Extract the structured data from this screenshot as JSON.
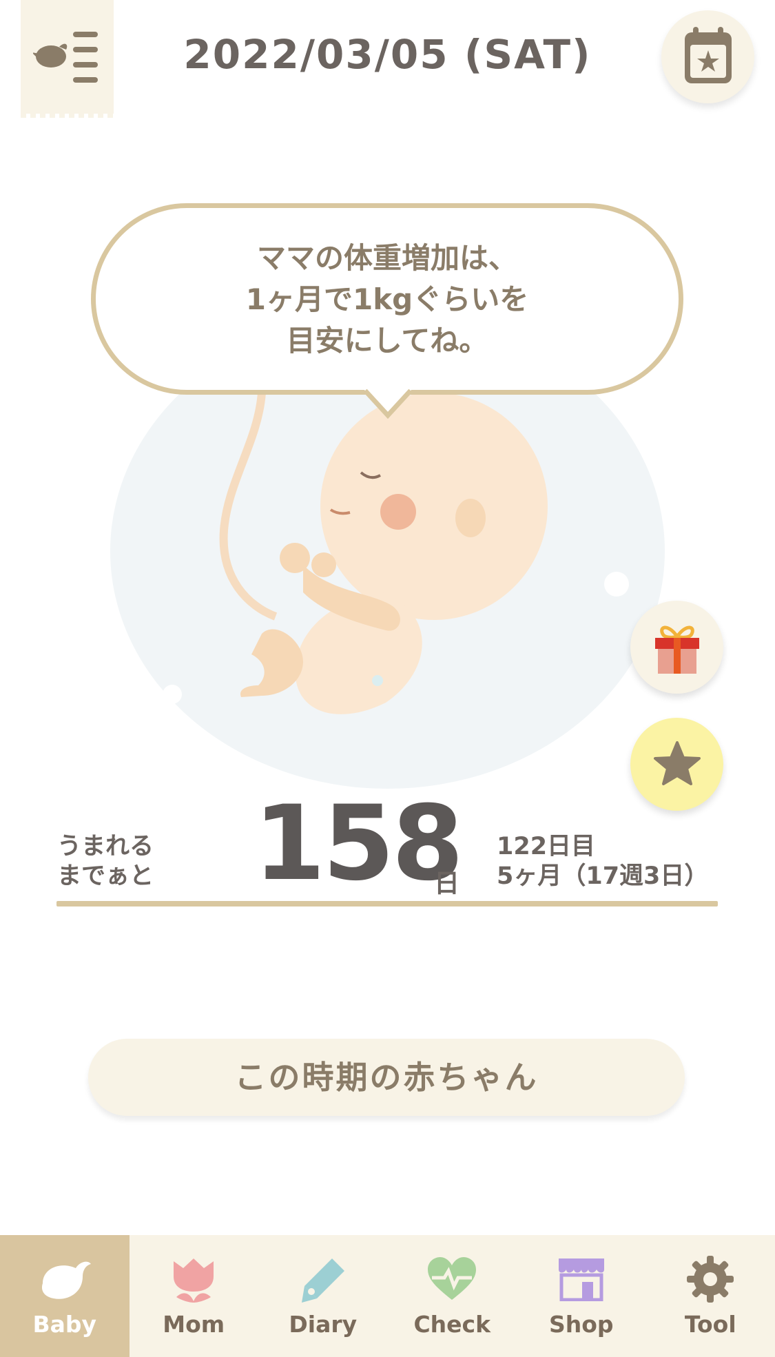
{
  "header": {
    "date": "2022/03/05 (SAT)",
    "menu_icon": "bird-menu-icon",
    "calendar_icon": "calendar-star-icon"
  },
  "bubble": {
    "lines": [
      "ママの体重増加は、",
      "1ヶ月で1kgぐらいを",
      "目安にしてね。"
    ]
  },
  "countdown": {
    "label_lines": [
      "うまれる",
      "までぁと"
    ],
    "days": "158",
    "days_unit": "日",
    "day_count": "122日目",
    "month_week": "5ヶ月（17週3日）"
  },
  "period_button": {
    "label": "この時期の赤ちゃん"
  },
  "side_buttons": {
    "gift_icon": "gift-icon",
    "star_icon": "star-icon"
  },
  "nav": {
    "items": [
      {
        "label": "Baby",
        "icon": "bird-icon",
        "active": true
      },
      {
        "label": "Mom",
        "icon": "tulip-icon",
        "active": false
      },
      {
        "label": "Diary",
        "icon": "pen-icon",
        "active": false
      },
      {
        "label": "Check",
        "icon": "heart-pulse-icon",
        "active": false
      },
      {
        "label": "Shop",
        "icon": "shop-icon",
        "active": false
      },
      {
        "label": "Tool",
        "icon": "gear-icon",
        "active": false
      }
    ]
  },
  "colors": {
    "accent": "#d9c79f",
    "cream": "#f8f3e6",
    "text": "#6b6460",
    "star_bg": "#fbf3a4"
  }
}
